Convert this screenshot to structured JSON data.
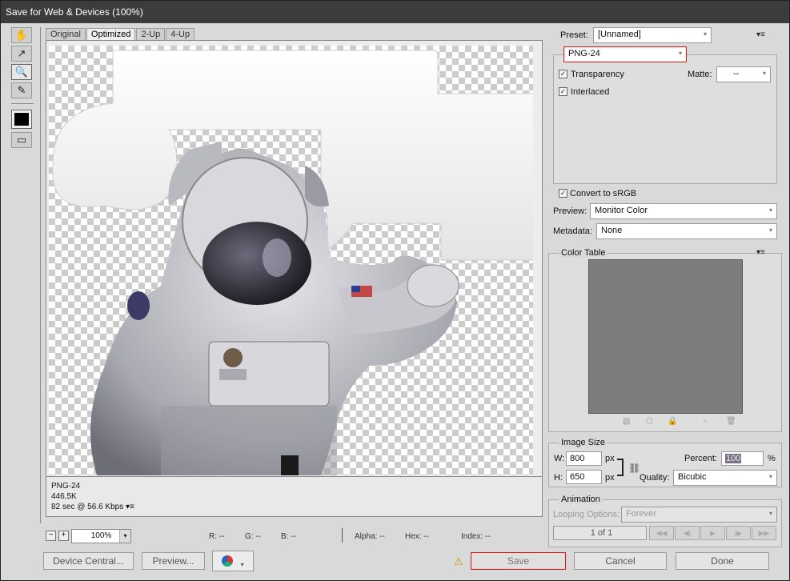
{
  "window": {
    "title": "Save for Web & Devices (100%)"
  },
  "tools": {
    "hand": "✋",
    "slice_select": "↗",
    "zoom": "🔍",
    "eyedropper": "✎",
    "preview_browser": "▭"
  },
  "tabs": [
    "Original",
    "Optimized",
    "2-Up",
    "4-Up"
  ],
  "image_info": {
    "format": "PNG-24",
    "size": "446,5K",
    "speed": "82 sec @ 56.6 Kbps"
  },
  "status_bar": {
    "zoom": "100%",
    "r": "R: --",
    "g": "G: --",
    "b": "B: --",
    "alpha": "Alpha: --",
    "hex": "Hex: --",
    "index": "Index: --"
  },
  "settings": {
    "preset_label": "Preset:",
    "preset_value": "[Unnamed]",
    "format_value": "PNG-24",
    "transparency_label": "Transparency",
    "transparency_checked": true,
    "matte_label": "Matte:",
    "matte_value": "--",
    "interlaced_label": "Interlaced",
    "interlaced_checked": true,
    "convert_label": "Convert to sRGB",
    "convert_checked": true,
    "preview_label": "Preview:",
    "preview_value": "Monitor Color",
    "metadata_label": "Metadata:",
    "metadata_value": "None"
  },
  "color_table": {
    "title": "Color Table",
    "icons": [
      "▨",
      "⬡",
      "🔒",
      "▫",
      "🗑"
    ]
  },
  "image_size": {
    "title": "Image Size",
    "w_label": "W:",
    "w_value": "800",
    "w_unit": "px",
    "h_label": "H:",
    "h_value": "650",
    "h_unit": "px",
    "percent_label": "Percent:",
    "percent_value": "100",
    "percent_unit": "%",
    "quality_label": "Quality:",
    "quality_value": "Bicubic"
  },
  "animation": {
    "title": "Animation",
    "looping_label": "Looping Options:",
    "looping_value": "Forever",
    "frame_counter": "1 of 1"
  },
  "buttons": {
    "device_central": "Device Central...",
    "preview": "Preview...",
    "save": "Save",
    "cancel": "Cancel",
    "done": "Done"
  },
  "colors": {
    "highlight_red": "#e11111",
    "color_table_bg": "#7d7d7d"
  }
}
